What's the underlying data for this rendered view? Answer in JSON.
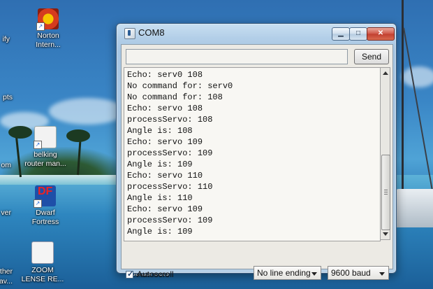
{
  "desktop": {
    "left_fragments": [
      "ify",
      "pts",
      "om",
      "ver",
      "ther",
      "av..."
    ],
    "icons": [
      {
        "name": "norton",
        "label_line1": "Norton",
        "label_line2": "Intern..."
      },
      {
        "name": "belkin",
        "label_line1": "belking",
        "label_line2": "router man..."
      },
      {
        "name": "dwarf-fortress",
        "label_line1": "Dwarf",
        "label_line2": "Fortress"
      },
      {
        "name": "zoom-lense",
        "label_line1": "ZOOM",
        "label_line2": "LENSE RE..."
      }
    ],
    "partial_label": "datasheets"
  },
  "window": {
    "title": "COM8",
    "send_label": "Send",
    "input_value": "",
    "output_lines": [
      "Echo: serv0 108",
      "No command for: serv0",
      "No command for: 108",
      "Echo: servo 108",
      "processServo: 108",
      "Angle is: 108",
      "Echo: servo 109",
      "processServo: 109",
      "Angle is: 109",
      "Echo: servo 110",
      "processServo: 110",
      "Angle is: 110",
      "Echo: servo 109",
      "processServo: 109",
      "Angle is: 109"
    ],
    "autoscroll_label": "Autoscroll",
    "autoscroll_checked": true,
    "line_ending": "No line ending",
    "baud": "9600 baud"
  },
  "colors": {
    "close_button": "#c94a3a",
    "window_frame": "#a7c6e3"
  }
}
